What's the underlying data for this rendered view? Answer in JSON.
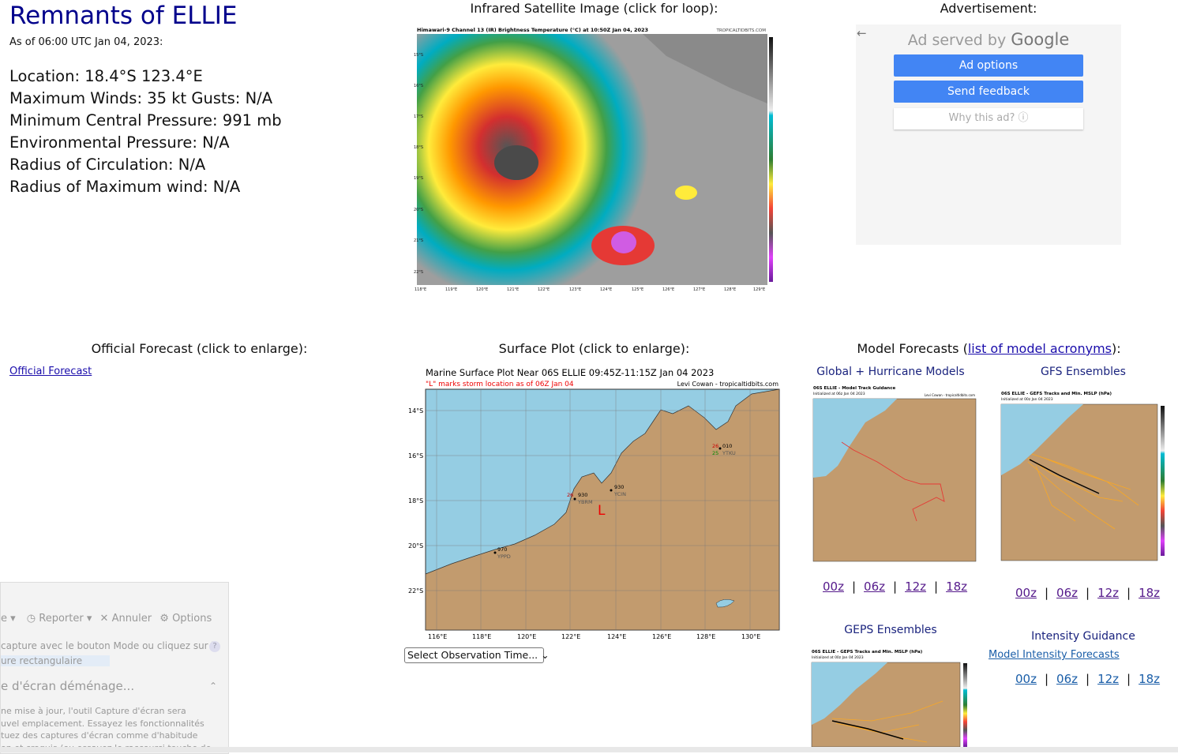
{
  "storm": {
    "title": "Remnants of ELLIE",
    "as_of": "As of 06:00 UTC Jan 04, 2023:",
    "location": "Location: 18.4°S 123.4°E",
    "max_winds": "Maximum Winds: 35 kt  Gusts: N/A",
    "min_pressure": "Minimum Central Pressure: 991 mb",
    "env_pressure": "Environmental Pressure: N/A",
    "radius_circ": "Radius of Circulation: N/A",
    "radius_max_wind": "Radius of Maximum wind: N/A"
  },
  "satellite": {
    "heading": "Infrared Satellite Image (click for loop):",
    "caption": "Himawari-9 Channel 13 (IR) Brightness Temperature (°C) at 10:50Z Jan 04, 2023",
    "credit": "TROPICALTIDBITS.COM",
    "lat_labels": [
      "15°S",
      "16°S",
      "17°S",
      "18°S",
      "19°S",
      "20°S",
      "21°S",
      "22°S"
    ],
    "lon_labels": [
      "118°E",
      "119°E",
      "120°E",
      "121°E",
      "122°E",
      "123°E",
      "124°E",
      "125°E",
      "126°E",
      "127°E",
      "128°E",
      "129°E"
    ],
    "scale_labels": [
      "40",
      "20",
      "0",
      "-20",
      "-30",
      "-40",
      "-50",
      "-60",
      "-70",
      "-80",
      "-90"
    ]
  },
  "ad": {
    "heading": "Advertisement:",
    "back_arrow": "←",
    "served_by": "Ad served by",
    "brand": "Google",
    "options": "Ad options",
    "feedback": "Send feedback",
    "why": "Why this ad? ⓘ"
  },
  "official": {
    "heading": "Official Forecast (click to enlarge):",
    "link": "Official Forecast"
  },
  "surface": {
    "heading": "Surface Plot (click to enlarge):",
    "title": "Marine Surface Plot Near 06S ELLIE 09:45Z-11:15Z Jan 04 2023",
    "subtitle": "\"L\" marks storm location as of 06Z Jan 04",
    "credit": "Levi Cowan - tropicaltidbits.com",
    "lat_labels": [
      "14°S",
      "16°S",
      "18°S",
      "20°S",
      "22°S"
    ],
    "lon_labels": [
      "116°E",
      "118°E",
      "120°E",
      "122°E",
      "124°E",
      "126°E",
      "128°E",
      "130°E"
    ],
    "storm_marker": "L",
    "stations": [
      {
        "temp": "26",
        "press": "930",
        "id": "YBRM"
      },
      {
        "temp": "",
        "press": "930",
        "id": "YCIN"
      },
      {
        "temp": "26",
        "press": "010",
        "id": "YTKU"
      },
      {
        "temp": "",
        "press": "970",
        "id": "YPPD"
      }
    ],
    "dew": "25",
    "select": "Select Observation Time... ⌄"
  },
  "models": {
    "heading_pre": "Model Forecasts (",
    "heading_link": "list of model acronyms",
    "heading_post": "):",
    "global_title": "Global + Hurricane Models",
    "global_img_title": "06S ELLIE - Model Track Guidance",
    "global_img_sub": "Initialized at 06z Jan 04 2023",
    "gefs_title": "GFS Ensembles",
    "gefs_img_title": "06S ELLIE - GEFS Tracks and Min. MSLP (hPa)",
    "gefs_img_sub": "Initialized at 00z Jan 04 2023",
    "geps_title": "GEPS Ensembles",
    "geps_img_title": "06S ELLIE - GEPS Tracks and Min. MSLP (hPa)",
    "geps_img_sub": "Initialized at 00z Jan 04 2023",
    "intensity_title": "Intensity Guidance",
    "intensity_link": "Model Intensity Forecasts",
    "runs": [
      "00z",
      "06z",
      "12z",
      "18z"
    ],
    "sep": "|",
    "img_credit": "Levi Cowan - tropicaltidbits.com"
  },
  "snip": {
    "menu": [
      "Reporter",
      "Annuler",
      "Options"
    ],
    "line1": "capture avec le bouton Mode ou cliquez sur le",
    "line2": "ure rectangulaire",
    "heading": "e d'écran déménage...",
    "p1": "ne mise à jour, l'outil Capture d'écran sera",
    "p2": "uvel emplacement. Essayez les fonctionnalités",
    "p3": "tuez des captures d'écran comme d'habitude",
    "p4": "on et croquis (ou essayez le raccourci touche de"
  },
  "colors": {
    "title": "#00008b",
    "ocean": "#95cde3",
    "land": "#c29b6e",
    "ad_button": "#4285f4"
  }
}
